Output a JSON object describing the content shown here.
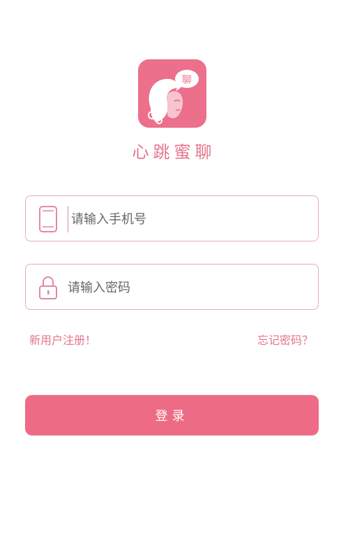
{
  "app": {
    "name": "心跳蜜聊",
    "logo_badge": "聊",
    "brand_color": "#ee6b86"
  },
  "form": {
    "phone": {
      "placeholder": "请输入手机号",
      "value": "",
      "icon": "phone-icon"
    },
    "password": {
      "placeholder": "请输入密码",
      "value": "",
      "icon": "lock-icon"
    }
  },
  "links": {
    "register": "新用户注册！",
    "forgot": "忘记密码？"
  },
  "login_button": "登录"
}
